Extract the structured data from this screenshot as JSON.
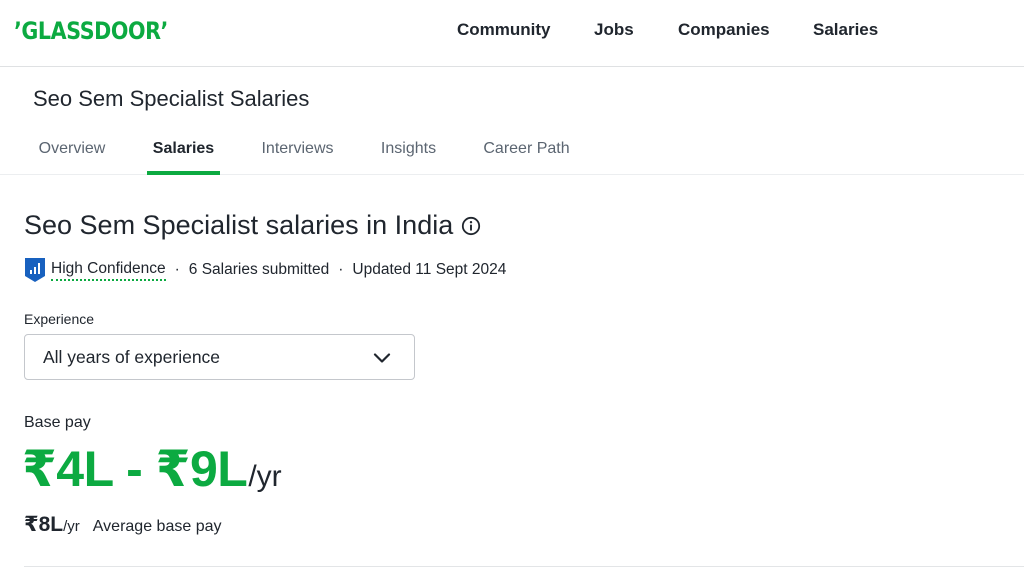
{
  "brand": {
    "logo_text": "’GLASSDOOR’",
    "color": "#0caa41"
  },
  "nav": {
    "items": [
      {
        "label": "Community"
      },
      {
        "label": "Jobs"
      },
      {
        "label": "Companies"
      },
      {
        "label": "Salaries"
      }
    ]
  },
  "page": {
    "title": "Seo Sem Specialist Salaries",
    "tabs": [
      {
        "label": "Overview",
        "active": false
      },
      {
        "label": "Salaries",
        "active": true
      },
      {
        "label": "Interviews",
        "active": false
      },
      {
        "label": "Insights",
        "active": false
      },
      {
        "label": "Career Path",
        "active": false
      }
    ]
  },
  "main": {
    "heading": "Seo Sem Specialist salaries in India",
    "info_icon": "info-circle-icon",
    "meta": {
      "confidence_icon": "shield-bar-chart-icon",
      "confidence": "High Confidence",
      "separator": "·",
      "salaries_submitted": "6 Salaries submitted",
      "updated": "Updated 11 Sept 2024"
    },
    "experience": {
      "label": "Experience",
      "selected": "All years of experience",
      "icon": "chevron-down-icon"
    },
    "base_pay": {
      "label": "Base pay",
      "range": "₹4L - ₹9L",
      "range_unit": "/yr",
      "average": "₹8L",
      "average_unit": "/yr",
      "average_label": "Average base pay"
    }
  },
  "colors": {
    "accent": "#0caa41",
    "text": "#20262e",
    "muted": "#5b6571",
    "shield": "#1861bf"
  }
}
